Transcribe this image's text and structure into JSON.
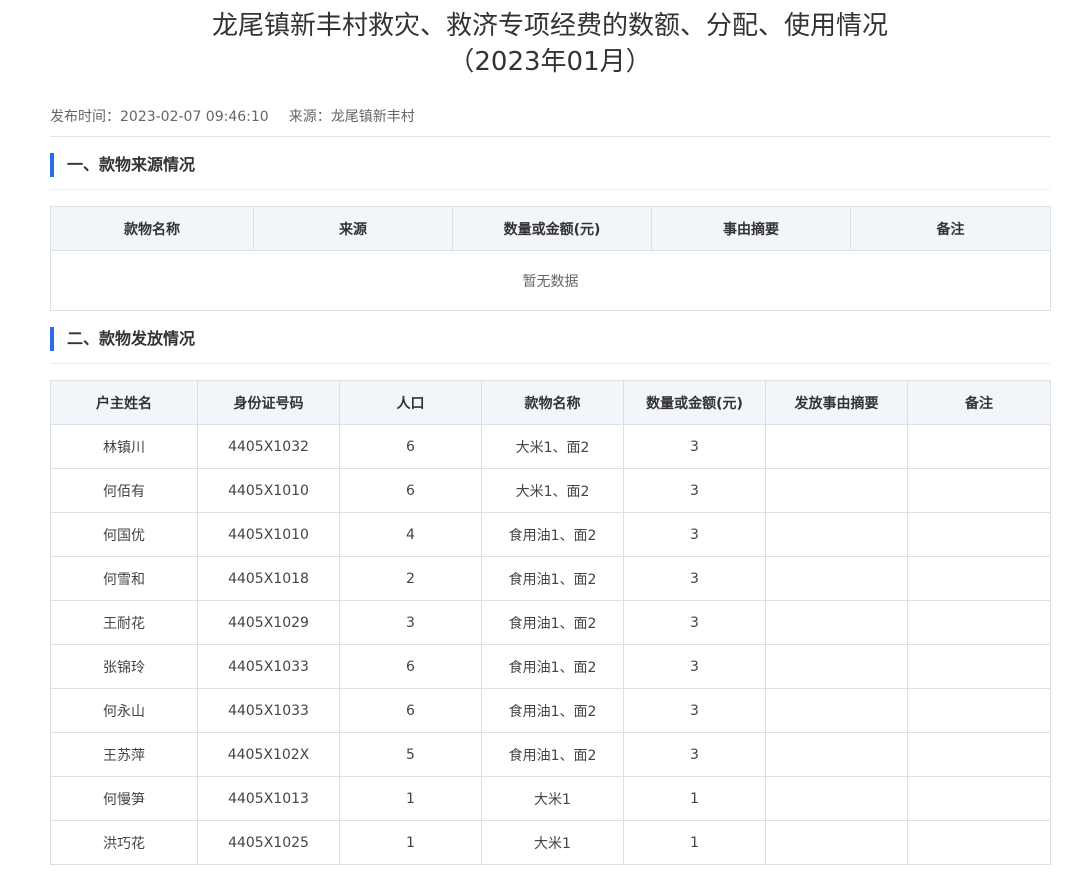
{
  "title": {
    "line1": "龙尾镇新丰村救灾、救济专项经费的数额、分配、使用情况",
    "line2": "（2023年01月）"
  },
  "meta": {
    "publish_time": "发布时间：2023-02-07 09:46:10",
    "source": "来源：龙尾镇新丰村"
  },
  "section1": {
    "heading": "一、款物来源情况",
    "columns": [
      "款物名称",
      "来源",
      "数量或金额(元)",
      "事由摘要",
      "备注"
    ],
    "empty_text": "暂无数据"
  },
  "section2": {
    "heading": "二、款物发放情况",
    "columns": [
      "户主姓名",
      "身份证号码",
      "人口",
      "款物名称",
      "数量或金额(元)",
      "发放事由摘要",
      "备注"
    ],
    "rows": [
      [
        "林镇川",
        "4405X1032",
        "6",
        "大米1、面2",
        "3",
        "",
        ""
      ],
      [
        "何佰有",
        "4405X1010",
        "6",
        "大米1、面2",
        "3",
        "",
        ""
      ],
      [
        "何国优",
        "4405X1010",
        "4",
        "食用油1、面2",
        "3",
        "",
        ""
      ],
      [
        "何雪和",
        "4405X1018",
        "2",
        "食用油1、面2",
        "3",
        "",
        ""
      ],
      [
        "王耐花",
        "4405X1029",
        "3",
        "食用油1、面2",
        "3",
        "",
        ""
      ],
      [
        "张锦玲",
        "4405X1033",
        "6",
        "食用油1、面2",
        "3",
        "",
        ""
      ],
      [
        "何永山",
        "4405X1033",
        "6",
        "食用油1、面2",
        "3",
        "",
        ""
      ],
      [
        "王苏萍",
        "4405X102X",
        "5",
        "食用油1、面2",
        "3",
        "",
        ""
      ],
      [
        "何慢笋",
        "4405X1013",
        "1",
        "大米1",
        "1",
        "",
        ""
      ],
      [
        "洪巧花",
        "4405X1025",
        "1",
        "大米1",
        "1",
        "",
        ""
      ]
    ]
  }
}
